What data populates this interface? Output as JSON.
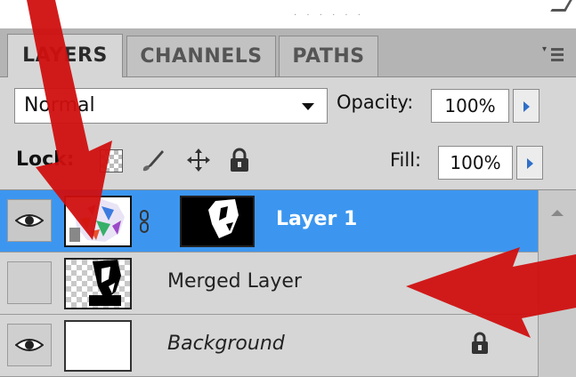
{
  "tabs": [
    {
      "label": "LAYERS",
      "active": true
    },
    {
      "label": "CHANNELS",
      "active": false
    },
    {
      "label": "PATHS",
      "active": false
    }
  ],
  "blend_mode": {
    "value": "Normal"
  },
  "opacity": {
    "label": "Opacity:",
    "value": "100%"
  },
  "lock": {
    "label": "Lock:"
  },
  "fill": {
    "label": "Fill:",
    "value": "100%"
  },
  "layers": [
    {
      "name": "Layer 1",
      "visible": true,
      "selected": true,
      "has_mask": true,
      "locked": false,
      "italic": false
    },
    {
      "name": "Merged Layer",
      "visible": false,
      "selected": false,
      "has_mask": false,
      "locked": false,
      "italic": false
    },
    {
      "name": "Background",
      "visible": true,
      "selected": false,
      "has_mask": false,
      "locked": true,
      "italic": true
    }
  ],
  "icons": {
    "eye": "eye-icon",
    "chain": "chain-link-icon",
    "lock": "lock-icon",
    "brush": "brush-icon",
    "move": "move-icon",
    "checker": "transparency-icon",
    "menu": "panel-menu-icon"
  },
  "colors": {
    "selection": "#3c96f0",
    "panel": "#d6d6d6",
    "annotation": "#d01010",
    "spin_arrow": "#2f6fc9"
  }
}
